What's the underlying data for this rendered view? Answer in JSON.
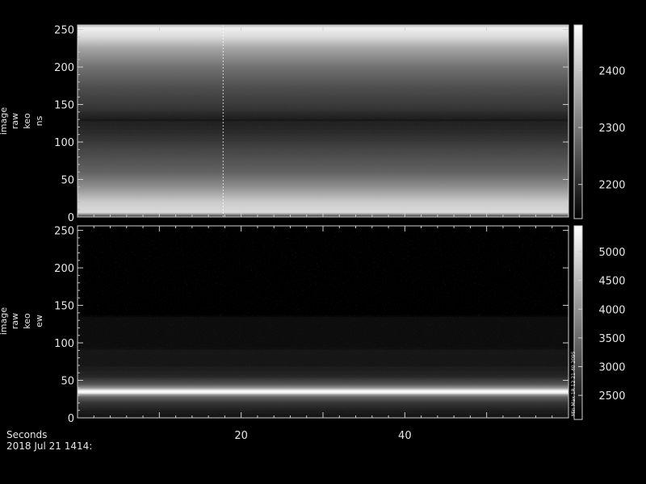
{
  "chart_data": [
    {
      "type": "heatmap",
      "panel": "top",
      "ylabel_lines": [
        "image",
        "raw",
        "keo",
        "ns"
      ],
      "ylim": [
        0,
        256
      ],
      "y_ticks": [
        0,
        50,
        100,
        150,
        200,
        250
      ],
      "xlim": [
        0,
        60
      ],
      "colorbar": {
        "range": [
          2140,
          2480
        ],
        "ticks": [
          2200,
          2300,
          2400
        ]
      },
      "background_rows": [
        [
          0,
          2200
        ],
        [
          6,
          2430
        ],
        [
          20,
          2410
        ],
        [
          40,
          2330
        ],
        [
          60,
          2270
        ],
        [
          90,
          2230
        ],
        [
          110,
          2200
        ],
        [
          131,
          2180
        ],
        [
          145,
          2210
        ],
        [
          170,
          2240
        ],
        [
          200,
          2290
        ],
        [
          225,
          2360
        ],
        [
          240,
          2430
        ],
        [
          252,
          2460
        ],
        [
          256,
          2380
        ]
      ],
      "features": [
        {
          "kind": "row_line",
          "y": 129,
          "value": 2170
        },
        {
          "kind": "column_line",
          "x": 17.8,
          "value": 2480
        }
      ]
    },
    {
      "type": "heatmap",
      "panel": "bottom",
      "ylabel_lines": [
        "image",
        "raw",
        "keo",
        "ew"
      ],
      "ylim": [
        0,
        256
      ],
      "y_ticks": [
        0,
        50,
        100,
        150,
        200,
        250
      ],
      "xlim": [
        0,
        60
      ],
      "x_ticks": [
        20,
        40
      ],
      "colorbar": {
        "range": [
          2080,
          5450
        ],
        "ticks": [
          2500,
          3000,
          3500,
          4000,
          4500,
          5000
        ]
      },
      "background_rows": [
        [
          0,
          2300
        ],
        [
          10,
          2500
        ],
        [
          20,
          2800
        ],
        [
          28,
          3400
        ],
        [
          31,
          4200
        ],
        [
          33,
          5200
        ],
        [
          35,
          5450
        ],
        [
          37,
          5100
        ],
        [
          40,
          4000
        ],
        [
          45,
          3200
        ],
        [
          55,
          2600
        ],
        [
          70,
          2400
        ],
        [
          100,
          2280
        ],
        [
          130,
          2180
        ],
        [
          160,
          2080
        ],
        [
          200,
          2120
        ],
        [
          256,
          2160
        ]
      ],
      "stamp": "Min Max 1R 12 21 40 2095"
    }
  ],
  "footer": {
    "xlabel": "Seconds",
    "date": "2018 Jul 21 1414:"
  }
}
